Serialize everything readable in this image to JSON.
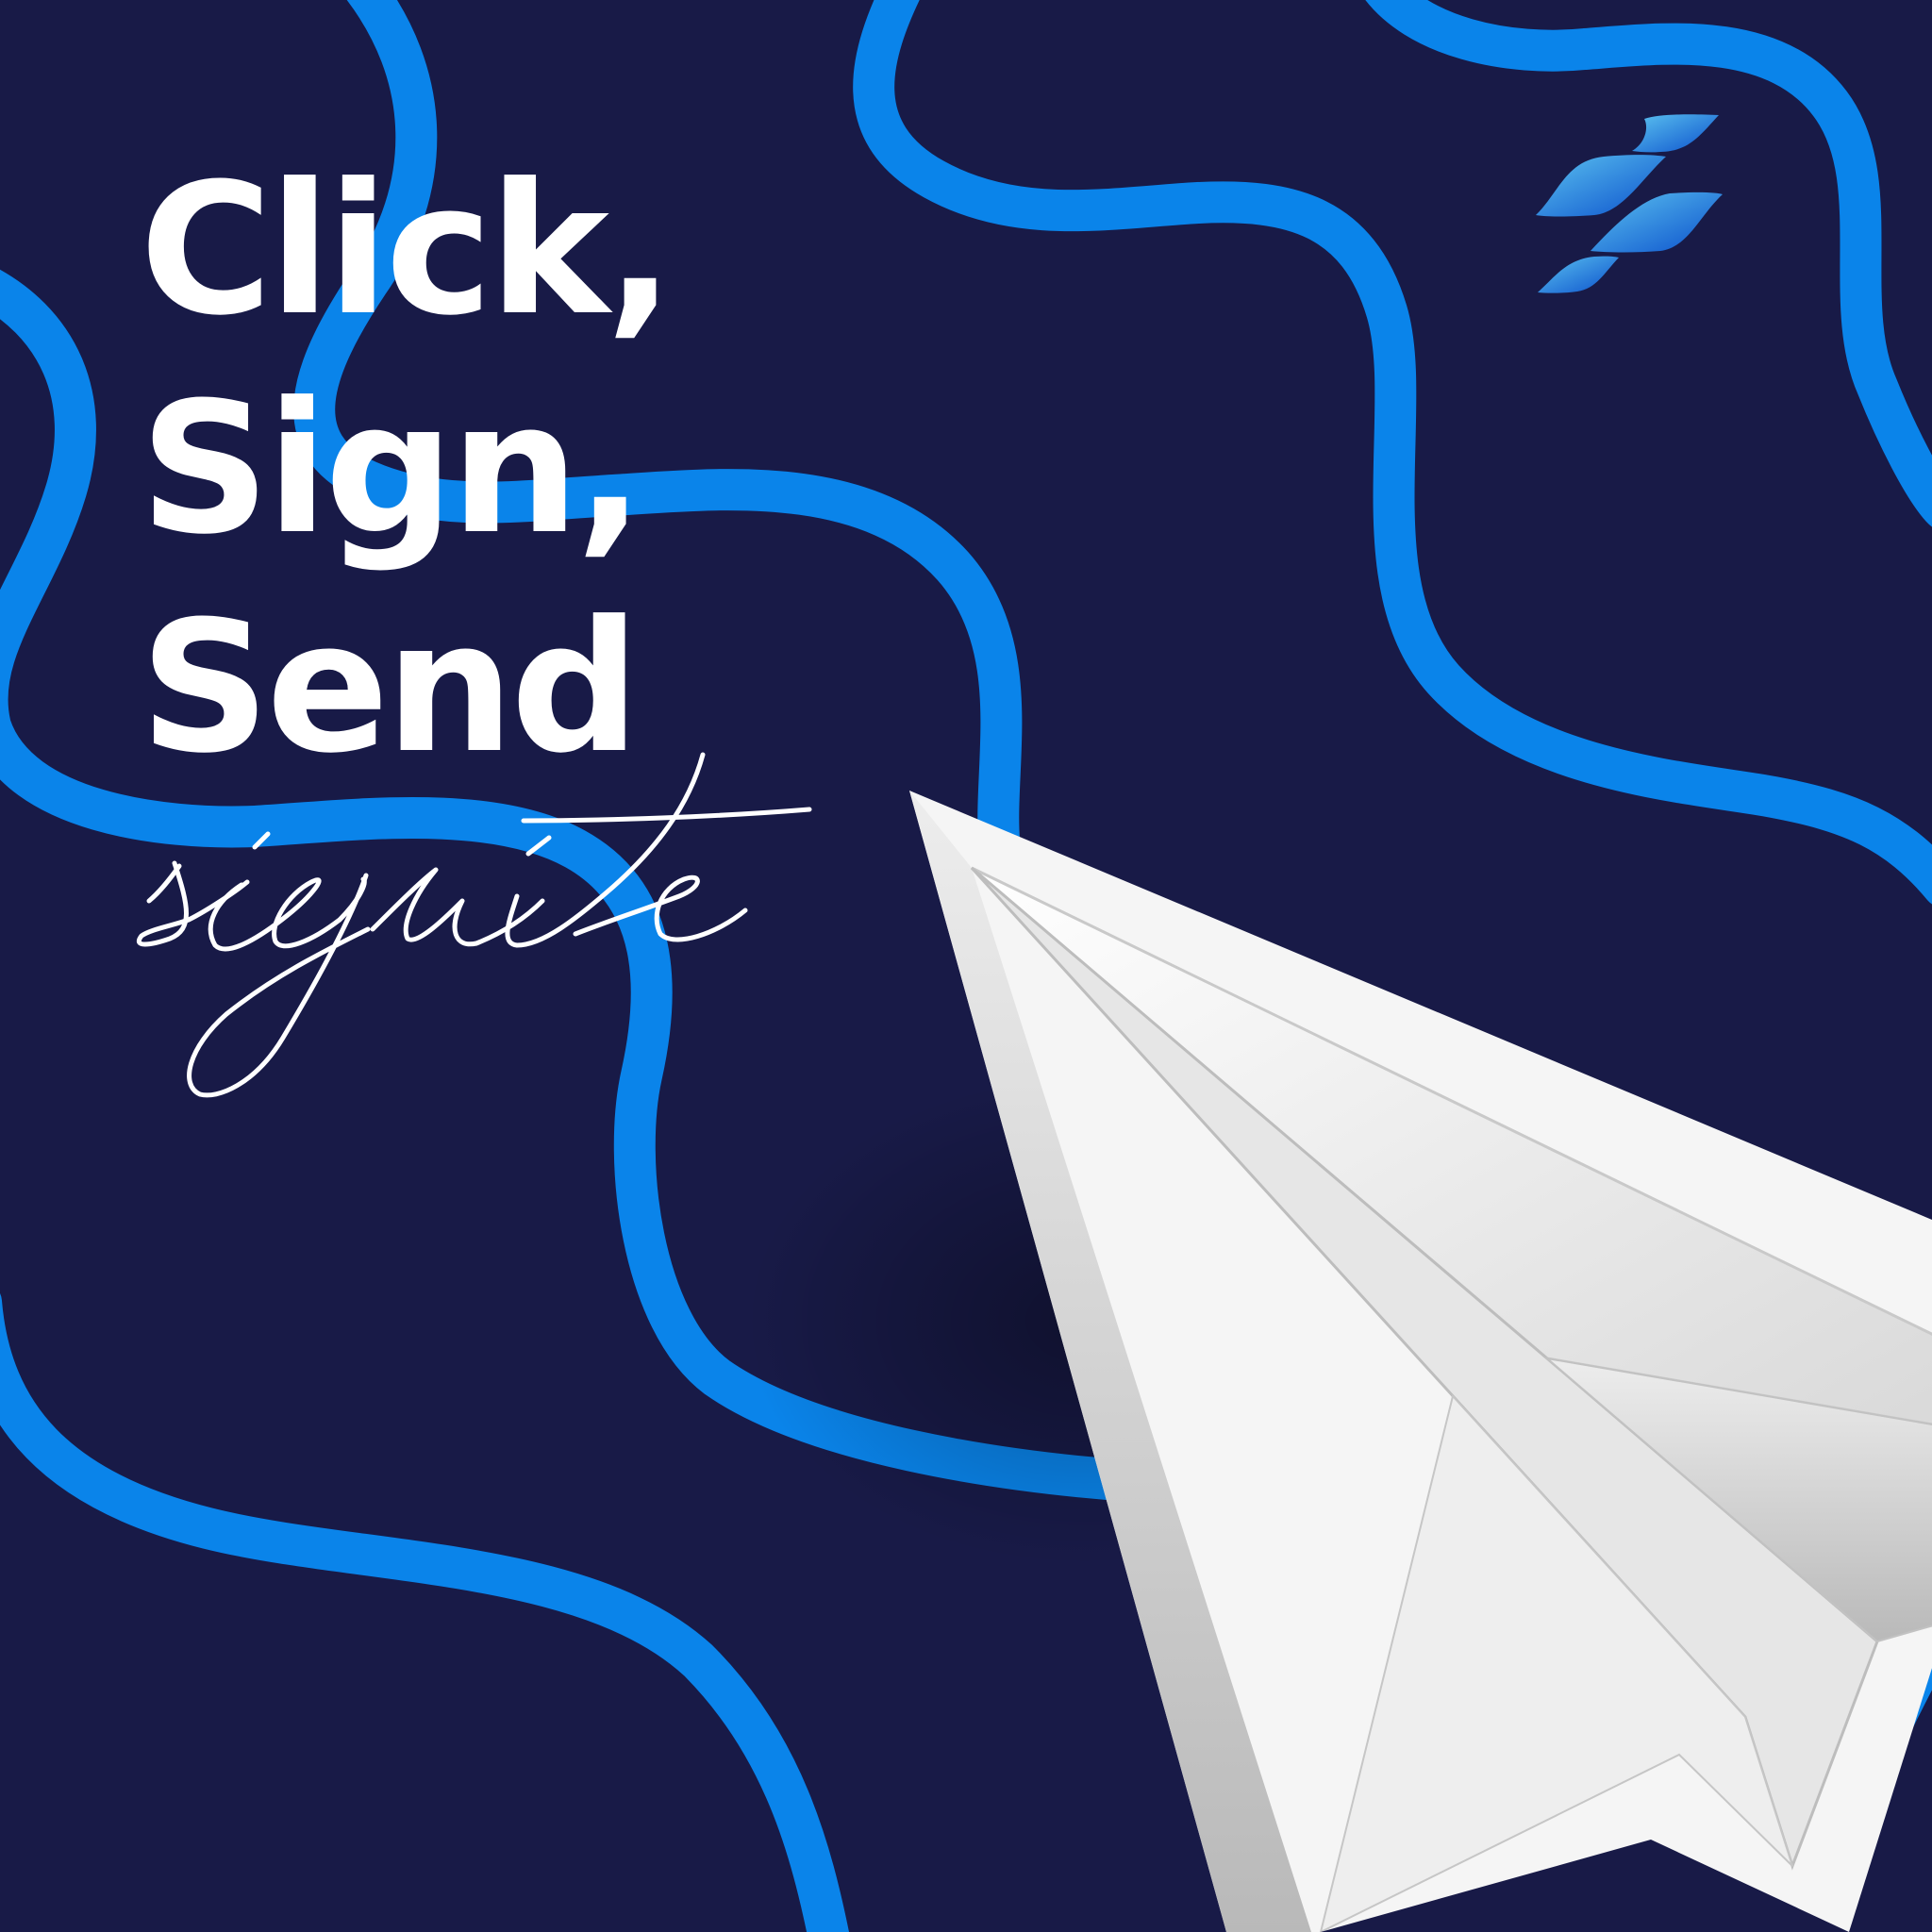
{
  "headline": {
    "line1": "Click,",
    "line2": "Sign,",
    "line3": "Send"
  },
  "brand": {
    "signature_word": "signite",
    "logo_icon": "signite-wave-logo-icon",
    "plane_icon": "paper-plane-icon"
  },
  "colors": {
    "background": "#181a47",
    "ribbon": "#0a84ea",
    "headline": "#ffffff",
    "plane": "#f1f1f1",
    "logo_light": "#5cc3f0",
    "logo_dark": "#0a5ad0"
  }
}
